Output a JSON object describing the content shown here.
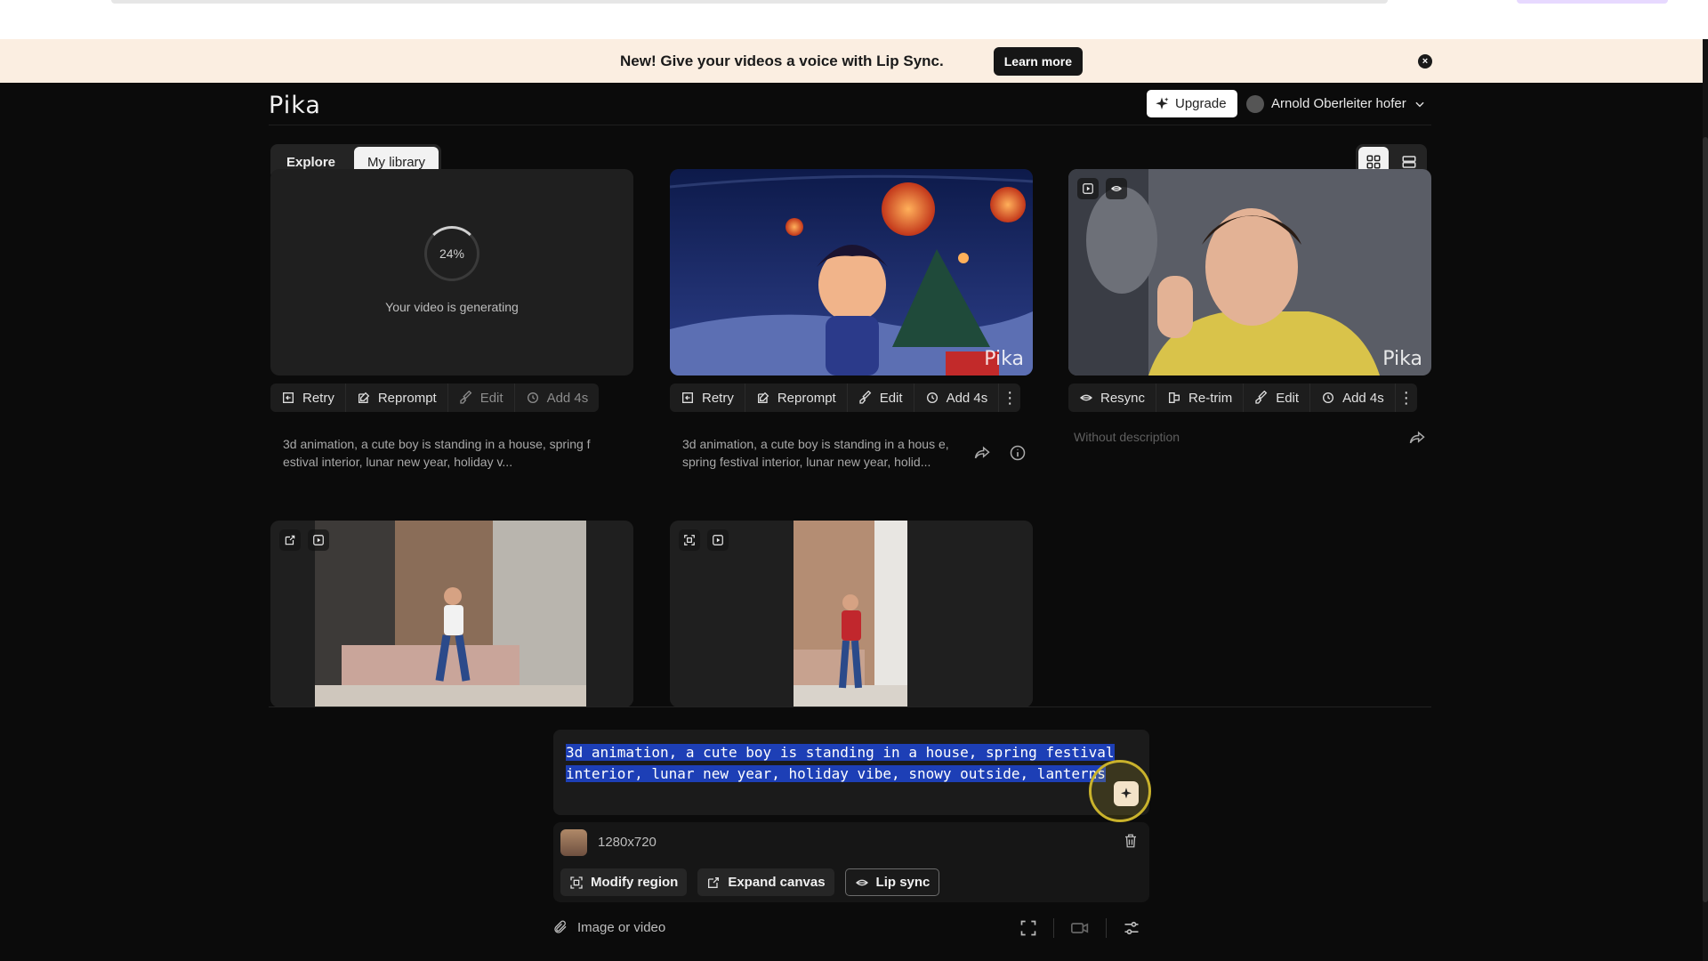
{
  "banner": {
    "text": "New! Give your videos a voice with Lip Sync.",
    "learn_more": "Learn more",
    "close_icon": "close-circle-icon"
  },
  "header": {
    "logo": "Pika",
    "upgrade": "Upgrade",
    "user_name": "Arnold Oberleiter hofer"
  },
  "tabs": [
    {
      "label": "Explore"
    },
    {
      "label": "My library",
      "active": true
    }
  ],
  "view_toggle": {
    "grid_icon": "grid-icon",
    "list_icon": "list-icon",
    "active": "grid"
  },
  "cards": [
    {
      "status": "Your video is generating",
      "progress_label": "24%",
      "progress": 0.24,
      "actions": [
        "Retry",
        "Reprompt",
        "Edit",
        "Add 4s"
      ],
      "description": "3d animation, a cute boy is standing in a house, spring f estival interior, lunar new year, holiday v..."
    },
    {
      "watermark": "Pika",
      "actions": [
        "Retry",
        "Reprompt",
        "Edit",
        "Add 4s"
      ],
      "description": "3d animation, a cute boy is standing in a hous e, spring festival interior, lunar new year, holid..."
    },
    {
      "watermark": "Pika",
      "actions": [
        "Resync",
        "Re-trim",
        "Edit",
        "Add 4s"
      ],
      "description": "Without description"
    }
  ],
  "prompt": {
    "line1": "3d animation, a cute boy is standing in a house, spring festival",
    "line2": "interior, lunar new year, holiday vibe, snowy outside, lanterns"
  },
  "media": {
    "size": "1280x720",
    "tools": [
      "Modify region",
      "Expand canvas",
      "Lip sync"
    ]
  },
  "attach_label": "Image or video",
  "colors": {
    "banner_bg": "#fbeee1",
    "selection": "#1d3fb6",
    "accent_ring": "#c9b22c"
  }
}
